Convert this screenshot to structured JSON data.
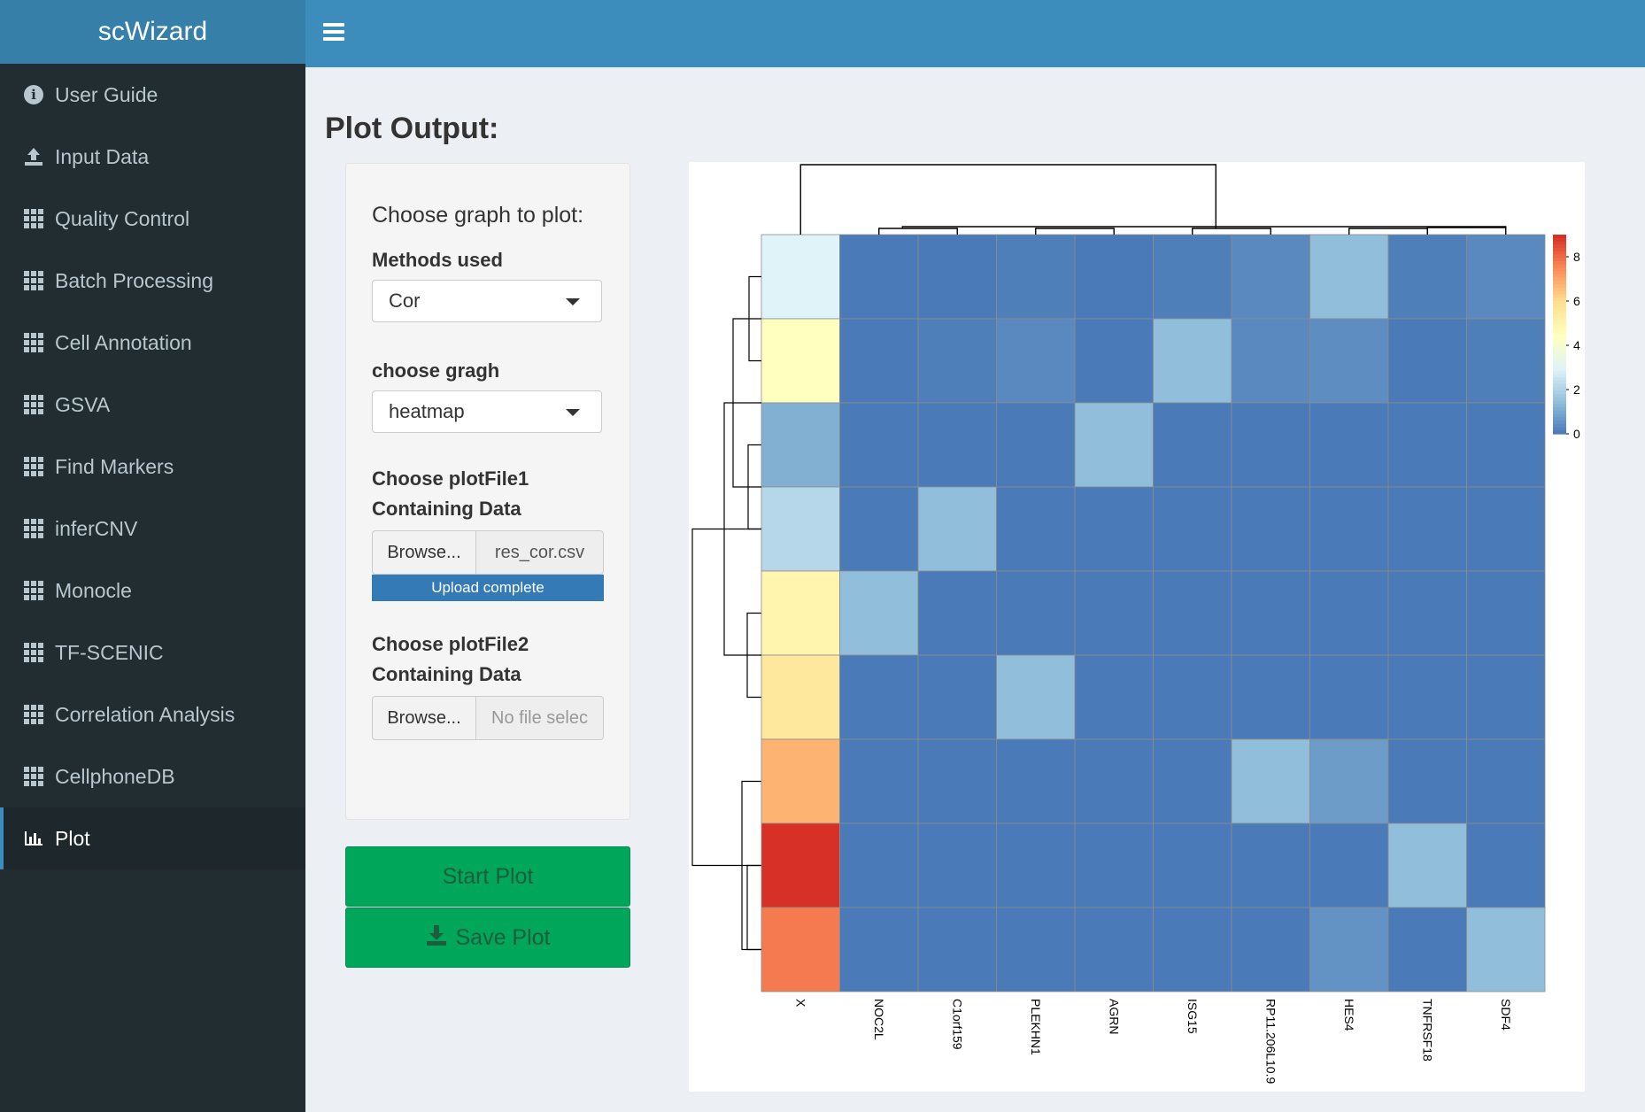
{
  "header": {
    "app_title": "scWizard"
  },
  "sidebar": {
    "items": [
      {
        "label": "User Guide",
        "icon": "info-icon"
      },
      {
        "label": "Input Data",
        "icon": "upload-icon"
      },
      {
        "label": "Quality Control",
        "icon": "grid-icon"
      },
      {
        "label": "Batch Processing",
        "icon": "grid-icon"
      },
      {
        "label": "Cell Annotation",
        "icon": "grid-icon"
      },
      {
        "label": "GSVA",
        "icon": "grid-icon"
      },
      {
        "label": "Find Markers",
        "icon": "grid-icon"
      },
      {
        "label": "inferCNV",
        "icon": "grid-icon"
      },
      {
        "label": "Monocle",
        "icon": "grid-icon"
      },
      {
        "label": "TF-SCENIC",
        "icon": "grid-icon"
      },
      {
        "label": "Correlation Analysis",
        "icon": "grid-icon"
      },
      {
        "label": "CellphoneDB",
        "icon": "grid-icon"
      },
      {
        "label": "Plot",
        "icon": "bar-chart-icon",
        "active": true
      }
    ]
  },
  "main": {
    "title": "Plot Output:",
    "form": {
      "choose_graph_label": "Choose graph to plot:",
      "methods_label": "Methods used",
      "methods_value": "Cor",
      "graph_label": "choose gragh",
      "graph_value": "heatmap",
      "file1_label_line1": "Choose plotFile1",
      "file1_label_line2": "Containing Data",
      "file1_browse": "Browse...",
      "file1_name": "res_cor.csv",
      "file1_progress": "Upload complete",
      "file1_progress_fraction": 1.0,
      "file2_label_line1": "Choose plotFile2",
      "file2_label_line2": "Containing Data",
      "file2_browse": "Browse...",
      "file2_name": "No file selec"
    },
    "buttons": {
      "start": "Start Plot",
      "save": "Save Plot"
    }
  },
  "chart_data": {
    "type": "heatmap",
    "columns": [
      "X",
      "NOC2L",
      "C1orf159",
      "PLEKHN1",
      "AGRN",
      "ISG15",
      "RP11.206L10.9",
      "HES4",
      "TNFRSF18",
      "SDF4"
    ],
    "rows": 9,
    "values": [
      [
        3.0,
        0.1,
        0.1,
        0.2,
        0.1,
        0.2,
        0.4,
        1.5,
        0.2,
        0.4
      ],
      [
        4.5,
        0.1,
        0.2,
        0.4,
        0.1,
        1.5,
        0.4,
        0.5,
        0.1,
        0.2
      ],
      [
        1.2,
        0.1,
        0.1,
        0.1,
        1.5,
        0.1,
        0.1,
        0.1,
        0.1,
        0.1
      ],
      [
        2.2,
        0.1,
        1.5,
        0.1,
        0.1,
        0.1,
        0.1,
        0.1,
        0.1,
        0.1
      ],
      [
        5.0,
        1.5,
        0.1,
        0.1,
        0.1,
        0.1,
        0.1,
        0.1,
        0.1,
        0.1
      ],
      [
        5.6,
        0.1,
        0.1,
        1.5,
        0.1,
        0.1,
        0.1,
        0.1,
        0.1,
        0.1
      ],
      [
        6.8,
        0.1,
        0.1,
        0.1,
        0.1,
        0.1,
        1.5,
        0.8,
        0.1,
        0.1
      ],
      [
        9.0,
        0.1,
        0.1,
        0.1,
        0.1,
        0.1,
        0.1,
        0.1,
        1.5,
        0.1
      ],
      [
        7.8,
        0.1,
        0.1,
        0.1,
        0.1,
        0.1,
        0.1,
        0.6,
        0.1,
        1.5
      ]
    ],
    "legend": {
      "ticks": [
        0,
        2,
        4,
        6,
        8
      ],
      "range": [
        0,
        9
      ],
      "placement": "right"
    },
    "colors": [
      "#4575b4",
      "#91bfdb",
      "#e0f3f8",
      "#ffffbf",
      "#fee090",
      "#fc8d59",
      "#d73027"
    ],
    "row_dendrogram": true,
    "column_dendrogram": true
  }
}
